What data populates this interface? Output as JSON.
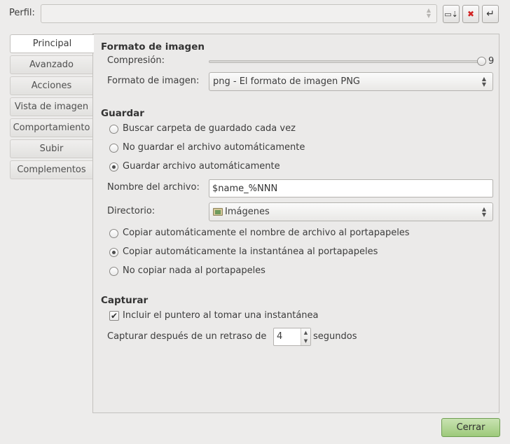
{
  "profile": {
    "label": "Perfil:",
    "value": ""
  },
  "toolbar": {
    "export_icon": "export-profile-icon",
    "delete_icon": "delete-profile-icon",
    "apply_icon": "apply-profile-icon"
  },
  "tabs": [
    {
      "label": "Principal",
      "active": true
    },
    {
      "label": "Avanzado",
      "active": false
    },
    {
      "label": "Acciones",
      "active": false
    },
    {
      "label": "Vista de imagen",
      "active": false
    },
    {
      "label": "Comportamiento",
      "active": false
    },
    {
      "label": "Subir",
      "active": false
    },
    {
      "label": "Complementos",
      "active": false
    }
  ],
  "image_format": {
    "title": "Formato de imagen",
    "compression_label": "Compresión:",
    "compression_value": "9",
    "compression_max": 9,
    "format_label": "Formato de imagen:",
    "format_value": "png - El formato de imagen PNG"
  },
  "save": {
    "title": "Guardar",
    "options": [
      {
        "label": "Buscar carpeta de guardado cada vez",
        "checked": false
      },
      {
        "label": "No guardar el archivo automáticamente",
        "checked": false
      },
      {
        "label": "Guardar archivo automáticamente",
        "checked": true
      }
    ],
    "filename_label": "Nombre del archivo:",
    "filename_value": "$name_%NNN",
    "directory_label": "Directorio:",
    "directory_value": "Imágenes",
    "clipboard_options": [
      {
        "label": "Copiar automáticamente el nombre de archivo al portapapeles",
        "checked": false
      },
      {
        "label": "Copiar automáticamente la instantánea al portapapeles",
        "checked": true
      },
      {
        "label": "No copiar nada al portapapeles",
        "checked": false
      }
    ]
  },
  "capture": {
    "title": "Capturar",
    "include_pointer_label": "Incluir el puntero al tomar una instantánea",
    "include_pointer_checked": true,
    "delay_label": "Capturar después de un retraso de",
    "delay_value": "4",
    "delay_unit": "segundos"
  },
  "footer": {
    "close_label": "Cerrar"
  },
  "colors": {
    "accent_button": "#9dca7a",
    "delete_icon": "#d22424"
  }
}
